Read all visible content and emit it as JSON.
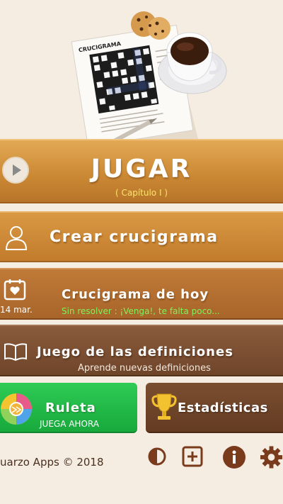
{
  "colors": {
    "background": "#f5ece2",
    "jugar": "#cc8a35",
    "crear": "#c9842f",
    "hoy": "#b06e31",
    "definiciones": "#7b4e33",
    "ruleta": "#22bb48",
    "estadisticas": "#6e4428",
    "subtitle_yellow": "#fde56a",
    "status_green": "#7cf35a",
    "footer_icons": "#7a3b1c"
  },
  "hero": {
    "image": "crossword-coffee-cookies-illustration",
    "newspaper_heading": "CRUCIGRAMA"
  },
  "menu": {
    "jugar": {
      "icon": "play-icon",
      "label": "JUGAR",
      "subtitle": "( Capítulo I )"
    },
    "crear": {
      "icon": "user-icon",
      "label": "Crear crucigrama"
    },
    "hoy": {
      "icon": "calendar-heart-icon",
      "date": "14 mar.",
      "label": "Crucigrama de hoy",
      "status": "Sin resolver : ¡Venga!, te falta poco..."
    },
    "definiciones": {
      "icon": "book-icon",
      "label": "Juego de las definiciones",
      "subtitle": "Aprende nuevas definiciones"
    },
    "ruleta": {
      "icon": "roulette-wheel-icon",
      "label": "Ruleta",
      "subtitle": "JUEGA AHORA"
    },
    "estadisticas": {
      "icon": "trophy-icon",
      "label": "Estadísticas"
    }
  },
  "footer": {
    "copyright": "uarzo Apps  © 2018",
    "icons": [
      "contrast-icon",
      "plus-box-icon",
      "info-icon",
      "settings-icon"
    ]
  }
}
